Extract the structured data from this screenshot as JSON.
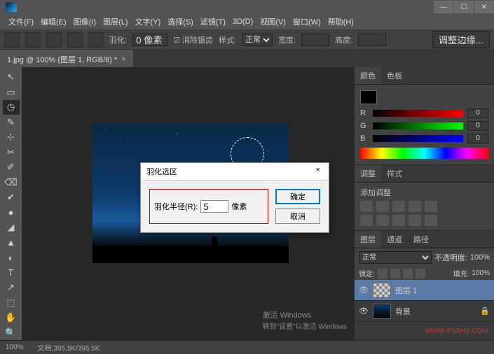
{
  "menu": {
    "file": "文件(F)",
    "edit": "编辑(E)",
    "image": "图像(I)",
    "layer": "图层(L)",
    "type": "文字(Y)",
    "select": "选择(S)",
    "filter": "滤镜(T)",
    "3d": "3D(D)",
    "view": "视图(V)",
    "window": "窗口(W)",
    "help": "帮助(H)"
  },
  "optbar": {
    "feather_label": "羽化:",
    "feather_val": "0 像素",
    "antialias": "消除锯齿",
    "style_label": "样式:",
    "style_val": "正常",
    "width_label": "宽度:",
    "height_label": "高度:",
    "refine": "调整边缘..."
  },
  "doc": {
    "tab": "1.jpg @ 100% (图层 1, RGB/8) *",
    "close": "×"
  },
  "tools": [
    "↖",
    "▭",
    "◷",
    "✎",
    "⊹",
    "✂",
    "✐",
    "⌫",
    "✔",
    "●",
    "◢",
    "▲",
    "◐",
    "T",
    "↗",
    "⬚",
    "✋",
    "🔍"
  ],
  "panels": {
    "color_tab": "颜色",
    "swatch_tab": "色板",
    "r": "R",
    "g": "G",
    "b": "B",
    "r_val": "0",
    "g_val": "0",
    "b_val": "0",
    "adj_tab": "调整",
    "style_tab": "样式",
    "adj_title": "添加调整",
    "layers_tab": "图层",
    "channels_tab": "通道",
    "paths_tab": "路径",
    "blend": "正常",
    "opacity_label": "不透明度:",
    "opacity_val": "100%",
    "lock_label": "锁定:",
    "fill_label": "填充:",
    "fill_val": "100%",
    "layer1": "图层 1",
    "bg_layer": "背景",
    "eye": "👁",
    "lock": "🔒"
  },
  "dialog": {
    "title": "羽化选区",
    "close": "×",
    "radius_label": "羽化半径(R):",
    "radius_val": "5",
    "unit": "像素",
    "ok": "确定",
    "cancel": "取消"
  },
  "status": {
    "zoom": "100%",
    "docsize": "文档:395.5K/395.5K"
  },
  "watermark": {
    "line1": "激活 Windows",
    "line2": "转到\"设置\"以激活 Windows"
  },
  "url": "WWW.PSAHZ.COM"
}
